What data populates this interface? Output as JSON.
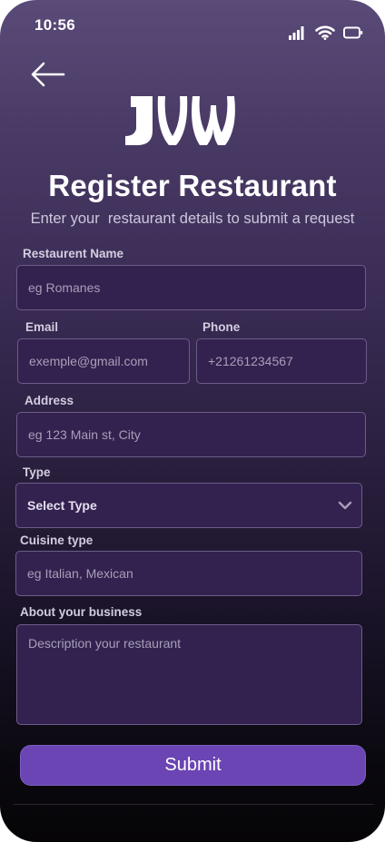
{
  "status_bar": {
    "time": "10:56",
    "icons": [
      "signal-icon",
      "wifi-icon",
      "battery-icon"
    ]
  },
  "header": {
    "back_icon": "back-arrow-icon",
    "logo": "brand-logo",
    "title": "Register Restaurant",
    "subtitle": "Enter your  restaurant details to submit a request"
  },
  "form": {
    "restaurant_name": {
      "label": "Restaurent Name",
      "placeholder": "eg Romanes"
    },
    "email": {
      "label": "Email",
      "placeholder": "exemple@gmail.com"
    },
    "phone": {
      "label": "Phone",
      "placeholder": "+21261234567"
    },
    "address": {
      "label": "Address",
      "placeholder": "eg 123 Main st, City"
    },
    "type": {
      "label": "Type",
      "selected": "Select Type"
    },
    "cuisine": {
      "label": "Cuisine type",
      "placeholder": "eg Italian, Mexican"
    },
    "about": {
      "label": "About your business",
      "placeholder": "Description your restaurant"
    },
    "submit_label": "Submit"
  },
  "colors": {
    "accent": "#6a45b3",
    "field_bg": "#33224f",
    "field_border": "#6c5c88"
  }
}
